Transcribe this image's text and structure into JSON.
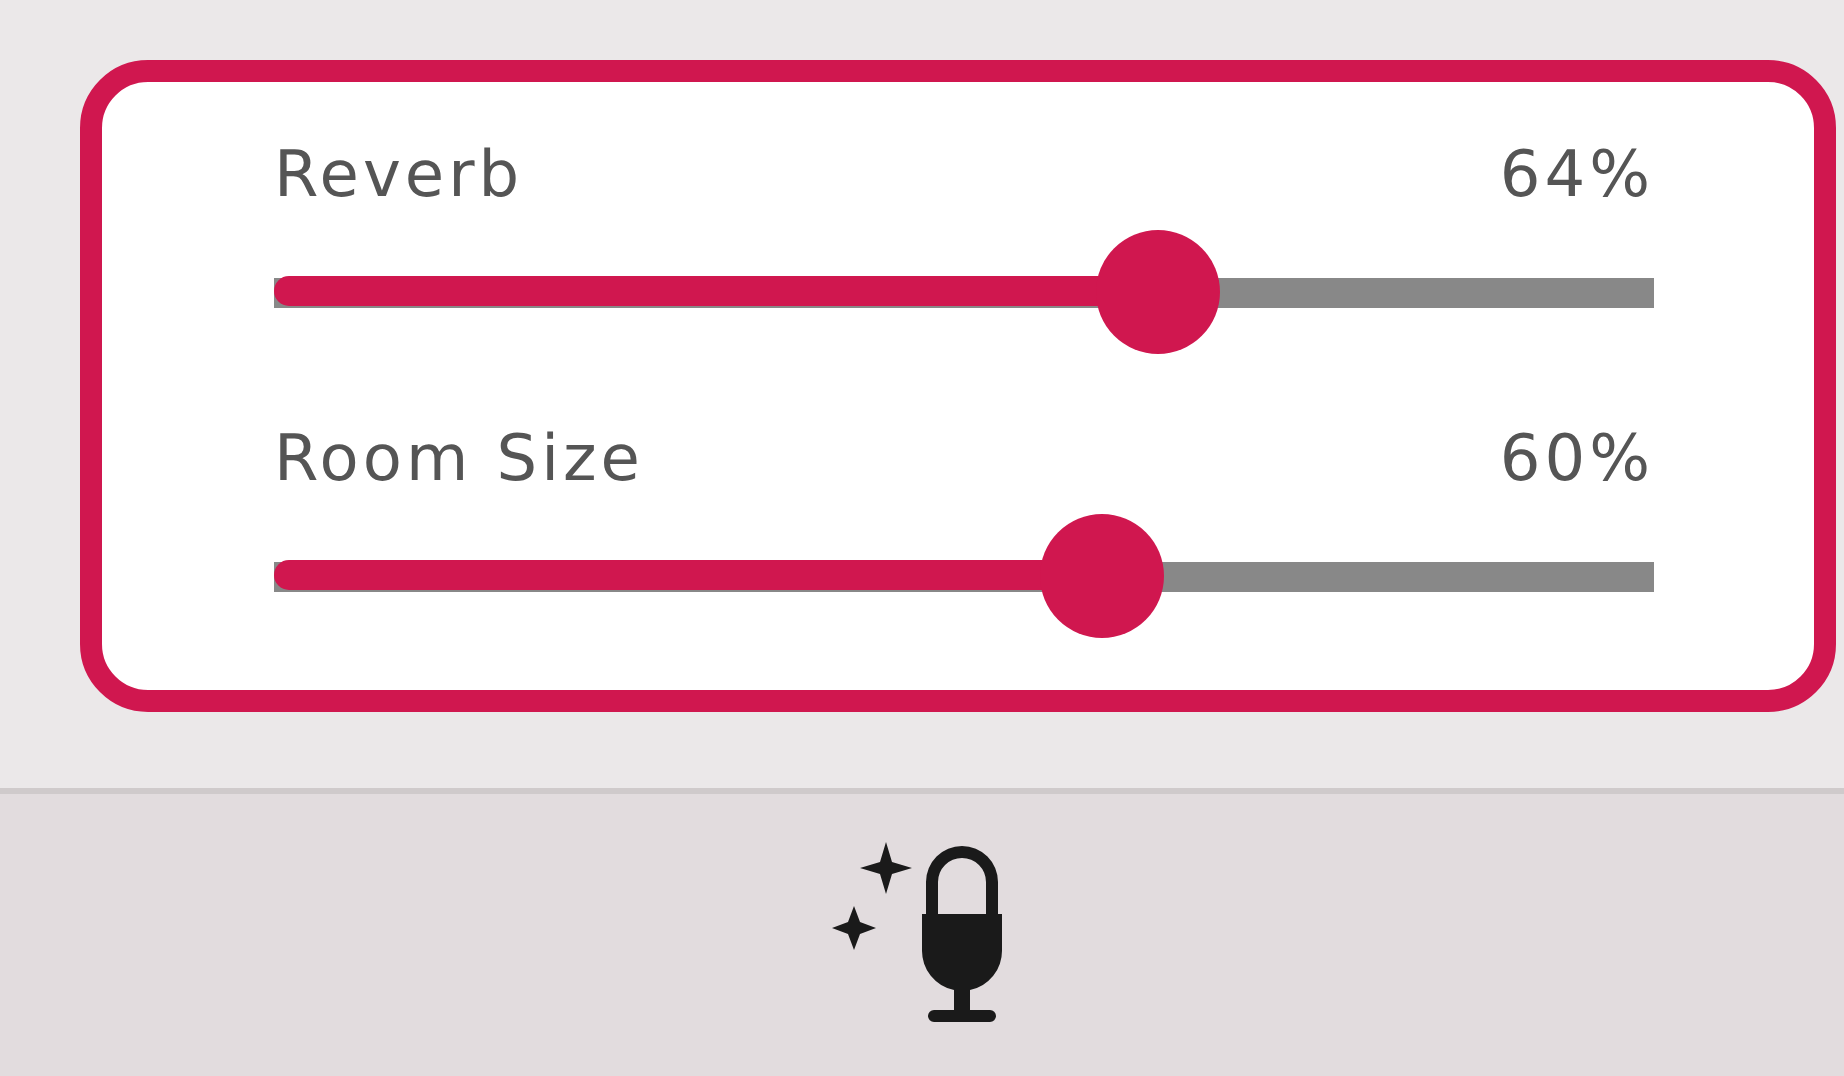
{
  "sliders": [
    {
      "label": "Reverb",
      "reading": "64%",
      "level": 0.64
    },
    {
      "label": "Room Size",
      "reading": "60%",
      "level": 0.6
    }
  ]
}
